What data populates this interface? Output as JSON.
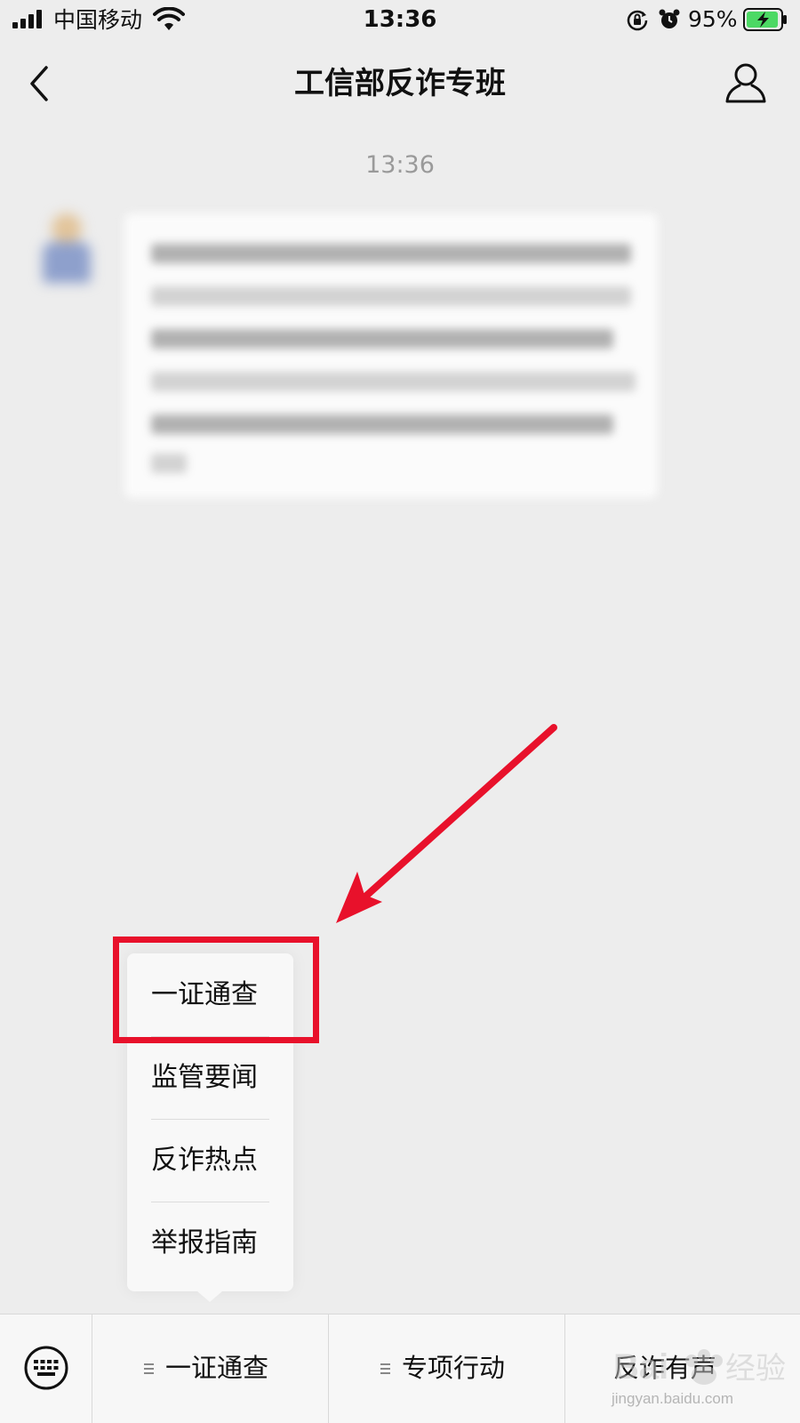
{
  "status_bar": {
    "carrier": "中国移动",
    "time": "13:36",
    "battery_percent": "95%",
    "battery_level": 0.95,
    "icons": [
      "signal-icon",
      "wifi-icon",
      "rotation-lock-icon",
      "alarm-icon",
      "battery-charging-icon"
    ]
  },
  "nav": {
    "title": "工信部反诈专班",
    "left_icon": "back-chevron-icon",
    "right_icon": "profile-icon"
  },
  "chat": {
    "message_time": "13:36",
    "message_blurred": true
  },
  "menu": {
    "items": [
      {
        "label": "一证通查"
      },
      {
        "label": "监管要闻"
      },
      {
        "label": "反诈热点"
      },
      {
        "label": "举报指南"
      }
    ]
  },
  "bottom_bar": {
    "keyboard_icon": "keyboard-icon",
    "tabs": [
      {
        "label": "一证通查"
      },
      {
        "label": "专项行动"
      },
      {
        "label": "反诈有声"
      }
    ]
  },
  "annotation": {
    "highlight_color": "#e8112b",
    "arrow_color": "#e8112b"
  },
  "watermark": {
    "text": "Baidu 经验",
    "url": "jingyan.baidu.com"
  }
}
